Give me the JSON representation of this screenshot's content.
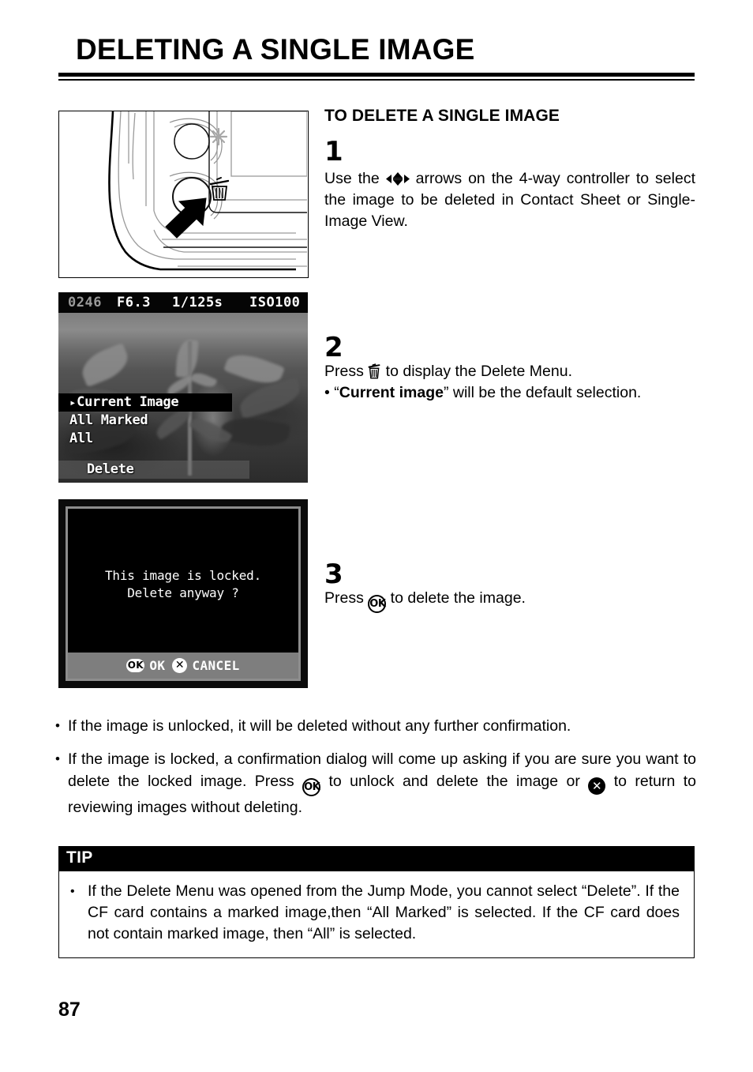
{
  "page": {
    "title": "DELETING A SINGLE IMAGE",
    "number": "87"
  },
  "section": {
    "heading": "TO DELETE A SINGLE IMAGE"
  },
  "steps": [
    {
      "number": "1",
      "text_before_glyph": "Use the ",
      "glyph": "4-way-arrows-icon",
      "text_after_glyph": " arrows on the 4-way controller to select the image to be deleted in Contact Sheet or Single-Image View."
    },
    {
      "number": "2",
      "text_before_glyph": "Press ",
      "glyph": "trash-icon",
      "text_after_glyph": " to display the Delete Menu.",
      "sub_bullet": {
        "dot": "•",
        "quote_open": "“",
        "emphasis": "Current image",
        "quote_close": "”",
        "rest": " will be the default selection."
      }
    },
    {
      "number": "3",
      "text_before_glyph": "Press ",
      "glyph": "ok-button-icon",
      "text_after_glyph": " to delete the image."
    }
  ],
  "figures": {
    "camera": {
      "caption_icons": [
        "star-icon",
        "trash-icon"
      ],
      "callout": "arrow-pointing-to-delete-button"
    },
    "lcd": {
      "info_bar": {
        "frame_number": "0246",
        "aperture": "F6.3",
        "shutter_speed": "1/125s",
        "iso": "ISO100"
      },
      "menu": {
        "caret": "▸",
        "items": [
          {
            "label": "Current Image",
            "selected": true
          },
          {
            "label": "All Marked",
            "selected": false
          },
          {
            "label": "All",
            "selected": false
          }
        ],
        "footer_label": "Delete"
      }
    },
    "dialog": {
      "line1": "This image is locked.",
      "line2": "Delete anyway ?",
      "footer": {
        "ok_badge": "OK",
        "ok_label": "OK",
        "cancel_badge": "✕",
        "cancel_label": "CANCEL"
      }
    }
  },
  "notes": [
    {
      "dot": "•",
      "text": "If the image is unlocked, it will be deleted without any further confirmation."
    },
    {
      "dot": "•",
      "part1": "If the image is locked, a confirmation dialog will come up asking if you are sure you want to delete the locked image. Press ",
      "glyph1": "ok-button-icon",
      "part2": " to unlock and delete the image or ",
      "glyph2": "cancel-button-icon",
      "part3": " to return to reviewing images without deleting."
    }
  ],
  "tip": {
    "header": "TIP",
    "dot": "•",
    "text": "If the Delete Menu was opened from the Jump Mode, you cannot select “Delete”.  If the CF card contains a marked image,then “All Marked” is selected.  If the CF card does not contain marked image, then “All” is selected."
  },
  "colors": {
    "ink": "#000000",
    "paper": "#ffffff",
    "lcd_bezel": "#8d8d8d",
    "lcd_footer": "#7e7e7e"
  }
}
